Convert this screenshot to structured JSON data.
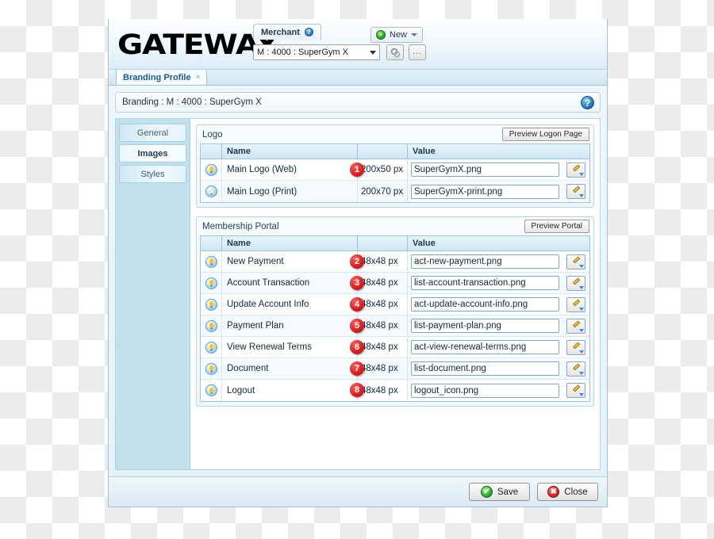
{
  "window": {
    "logo_text": "GATEWAY",
    "merchant_tab": {
      "label": "Merchant",
      "help_icon": "help-circle-icon",
      "help_glyph": "?"
    },
    "merchant_select": {
      "value": "M : 4000 : SuperGym X",
      "dropdown_icon": "chevron-down-icon"
    },
    "search_button": {
      "icon": "search-gears-icon"
    },
    "more_button": {
      "label": "..."
    },
    "new_button": {
      "label": "New",
      "icon": "plus-circle-icon",
      "icon_glyph": "+",
      "dropdown_icon": "chevron-down-icon"
    }
  },
  "tabs": [
    {
      "label": "Branding Profile",
      "close_glyph": "×",
      "active": true
    }
  ],
  "branding_bar": {
    "title": "Branding : M : 4000 : SuperGym X",
    "help_icon": "help-circle-icon",
    "help_glyph": "?"
  },
  "sidebar": {
    "items": [
      {
        "label": "General",
        "active": false
      },
      {
        "label": "Images",
        "active": true
      },
      {
        "label": "Styles",
        "active": false
      }
    ]
  },
  "groups": [
    {
      "title": "Logo",
      "preview_button": "Preview Logon Page",
      "columns": {
        "name": "Name",
        "size": "",
        "value": "Value"
      },
      "rows": [
        {
          "icon": "lightbulb-icon",
          "name": "Main Logo (Web)",
          "size": "200x50 px",
          "value": "SuperGymX.png",
          "badge": "1",
          "edit_icon": "pencil-edit-icon"
        },
        {
          "icon": "lightbulb-icon",
          "name": "Main Logo (Print)",
          "size": "200x70 px",
          "value": "SuperGymX-print.png",
          "badge": "",
          "edit_icon": "pencil-edit-icon"
        }
      ]
    },
    {
      "title": "Membership Portal",
      "preview_button": "Preview Portal",
      "columns": {
        "name": "Name",
        "size": "",
        "value": "Value"
      },
      "rows": [
        {
          "icon": "lightbulb-icon",
          "name": "New Payment",
          "size": "48x48 px",
          "value": "act-new-payment.png",
          "badge": "2",
          "edit_icon": "pencil-edit-icon"
        },
        {
          "icon": "lightbulb-icon",
          "name": "Account Transaction",
          "size": "48x48 px",
          "value": "list-account-transaction.png",
          "badge": "3",
          "edit_icon": "pencil-edit-icon"
        },
        {
          "icon": "lightbulb-icon",
          "name": "Update Account Info",
          "size": "48x48 px",
          "value": "act-update-account-info.png",
          "badge": "4",
          "edit_icon": "pencil-edit-icon"
        },
        {
          "icon": "lightbulb-icon",
          "name": "Payment Plan",
          "size": "48x48 px",
          "value": "list-payment-plan.png",
          "badge": "5",
          "edit_icon": "pencil-edit-icon"
        },
        {
          "icon": "lightbulb-icon",
          "name": "View Renewal Terms",
          "size": "48x48 px",
          "value": "act-view-renewal-terms.png",
          "badge": "6",
          "edit_icon": "pencil-edit-icon"
        },
        {
          "icon": "lightbulb-icon",
          "name": "Document",
          "size": "48x48 px",
          "value": "list-document.png",
          "badge": "7",
          "edit_icon": "pencil-edit-icon"
        },
        {
          "icon": "lightbulb-icon",
          "name": "Logout",
          "size": "48x48 px",
          "value": "logout_icon.png",
          "badge": "8",
          "edit_icon": "pencil-edit-icon"
        }
      ]
    }
  ],
  "footer": {
    "save": {
      "label": "Save",
      "icon": "check-circle-icon",
      "glyph": "✔"
    },
    "close": {
      "label": "Close",
      "icon": "x-circle-icon",
      "glyph": "✖"
    }
  },
  "colors": {
    "accent_blue": "#1a5a92",
    "badge_red": "#d61f22",
    "panel_blue": "#c3e0ef",
    "save_green": "#159625",
    "close_red": "#c4161c"
  }
}
